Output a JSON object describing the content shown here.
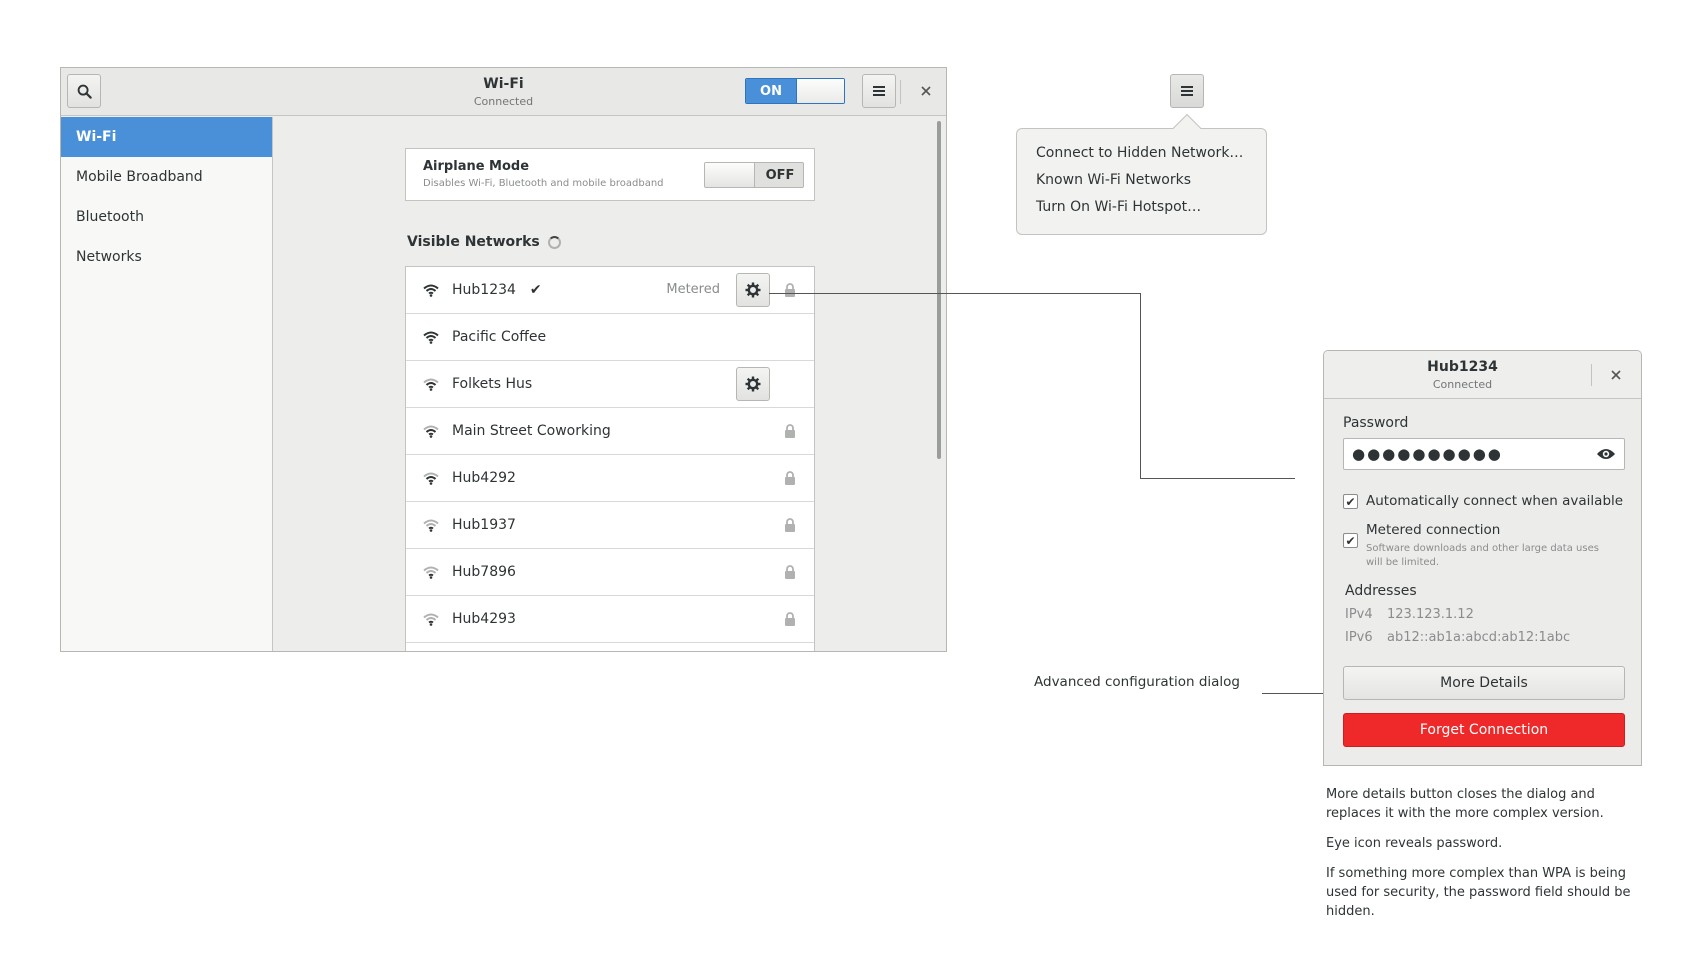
{
  "window": {
    "title": "Wi-Fi",
    "subtitle": "Connected",
    "wifi_switch": "ON"
  },
  "sidebar": {
    "items": [
      {
        "label": "Wi-Fi",
        "selected": true
      },
      {
        "label": "Mobile Broadband"
      },
      {
        "label": "Bluetooth"
      },
      {
        "label": "Networks"
      }
    ]
  },
  "airplane": {
    "title": "Airplane Mode",
    "subtitle": "Disables Wi-Fi, Bluetooth and mobile broadband",
    "switch": "OFF"
  },
  "visible_networks": {
    "title": "Visible Networks",
    "networks": [
      {
        "name": "Hub1234",
        "connected": true,
        "metered": "Metered",
        "settings": true,
        "locked": true
      },
      {
        "name": "Pacific Coffee"
      },
      {
        "name": "Folkets Hus",
        "settings": true
      },
      {
        "name": "Main Street Coworking",
        "locked": true
      },
      {
        "name": "Hub4292",
        "locked": true
      },
      {
        "name": "Hub1937",
        "locked": true
      },
      {
        "name": "Hub7896",
        "locked": true
      },
      {
        "name": "Hub4293",
        "locked": true
      }
    ]
  },
  "menu_popover": {
    "items": [
      "Connect to Hidden Network…",
      "Known Wi-Fi Networks",
      "Turn On Wi-Fi Hotspot…"
    ]
  },
  "dialog": {
    "title": "Hub1234",
    "subtitle": "Connected",
    "password_label": "Password",
    "password_value": "●●●●●●●●●●",
    "auto_connect": "Automatically connect when available",
    "metered_label": "Metered connection",
    "metered_sub": "Software downloads and other large data uses will be limited.",
    "addresses_title": "Addresses",
    "ipv4_label": "IPv4",
    "ipv4_value": "123.123.1.12",
    "ipv6_label": "IPv6",
    "ipv6_value": "ab12::ab1a:abcd:ab12:1abc",
    "more_details": "More Details",
    "forget": "Forget Connection"
  },
  "annotations": {
    "advanced_label": "Advanced configuration dialog",
    "notes": [
      "More details button closes the dialog and replaces it with the more complex version.",
      "Eye icon reveals password.",
      "If something more complex than WPA is being used for security, the password field should be hidden."
    ]
  },
  "colors": {
    "accent": "#4a90d9",
    "destructive": "#ef2929"
  }
}
